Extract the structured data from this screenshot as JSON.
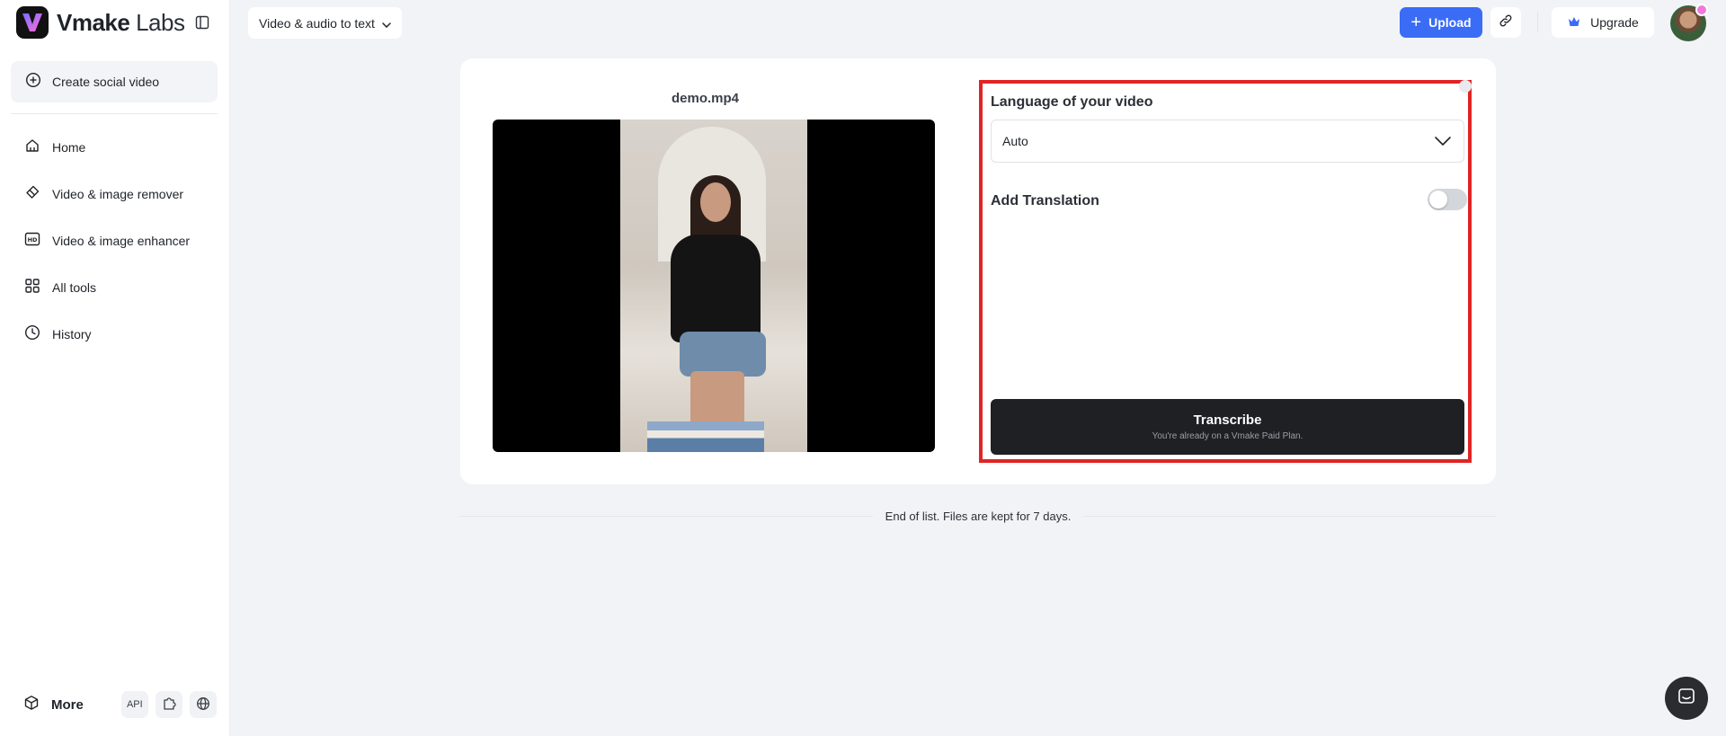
{
  "brand": {
    "name_bold": "Vmake",
    "name_light": " Labs"
  },
  "sidebar": {
    "create_label": "Create social video",
    "items": [
      {
        "label": "Home",
        "icon": "home-icon"
      },
      {
        "label": "Video & image remover",
        "icon": "eraser-icon"
      },
      {
        "label": "Video & image enhancer",
        "icon": "hd-icon"
      },
      {
        "label": "All tools",
        "icon": "grid-icon"
      },
      {
        "label": "History",
        "icon": "clock-icon"
      }
    ],
    "more_label": "More",
    "api_label": "API"
  },
  "topbar": {
    "tool_select": "Video & audio to text",
    "upload_label": "Upload",
    "upgrade_label": "Upgrade"
  },
  "main": {
    "file_name": "demo.mp4",
    "language_label": "Language of your video",
    "language_value": "Auto",
    "translation_label": "Add Translation",
    "translation_enabled": false,
    "transcribe_label": "Transcribe",
    "transcribe_sub": "You're already on a Vmake Paid Plan.",
    "end_text": "End of list. Files are kept for 7 days."
  },
  "colors": {
    "accent": "#3a6cf6",
    "highlight": "#e02424",
    "dark_button": "#1f2024"
  }
}
